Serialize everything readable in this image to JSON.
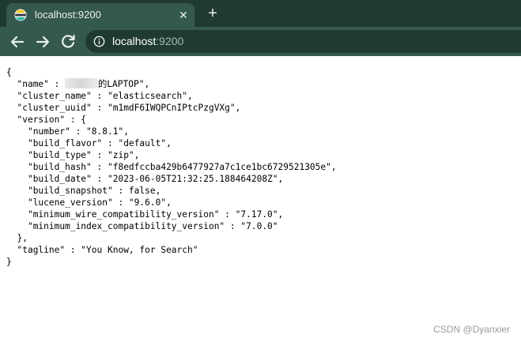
{
  "browser": {
    "tab": {
      "title": "localhost:9200",
      "favicon": "elasticsearch-favicon-icon"
    },
    "address_bar": {
      "host": "localhost",
      "port": ":9200"
    },
    "colors": {
      "tabstrip": "#1f3a33",
      "toolbar": "#35584f",
      "omnibox": "#1f3a33"
    }
  },
  "json": {
    "open_brace": "{",
    "close_brace": "}",
    "name": {
      "key": "\"name\" : ",
      "value_suffix": "的LAPTOP\","
    },
    "cluster_name": {
      "line": "\"cluster_name\" : \"elasticsearch\","
    },
    "cluster_uuid": {
      "line": "\"cluster_uuid\" : \"m1mdF6IWQPCnIPtcPzgVXg\","
    },
    "version_open": "\"version\" : {",
    "version": {
      "number": "\"number\" : \"8.8.1\",",
      "build_flavor": "\"build_flavor\" : \"default\",",
      "build_type": "\"build_type\" : \"zip\",",
      "build_hash": "\"build_hash\" : \"f8edfccba429b6477927a7c1ce1bc6729521305e\",",
      "build_date": "\"build_date\" : \"2023-06-05T21:32:25.188464208Z\",",
      "build_snapshot": "\"build_snapshot\" : false,",
      "lucene_version": "\"lucene_version\" : \"9.6.0\",",
      "minimum_wire_compatibility_version": "\"minimum_wire_compatibility_version\" : \"7.17.0\",",
      "minimum_index_compatibility_version": "\"minimum_index_compatibility_version\" : \"7.0.0\""
    },
    "version_close": "},",
    "tagline": "\"tagline\" : \"You Know, for Search\""
  },
  "watermark": "CSDN @Dyanxier"
}
